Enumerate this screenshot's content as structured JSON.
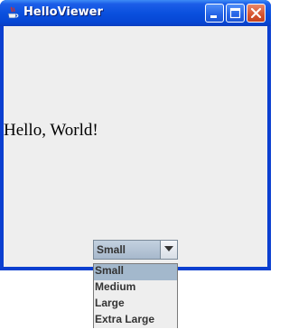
{
  "window": {
    "title": "HelloViewer",
    "icon": "java-cup-icon",
    "title_bar_color": "#0a50de",
    "close_button_color": "#d6532e"
  },
  "content": {
    "greeting": "Hello, World!"
  },
  "combo": {
    "selected": "Small",
    "options": [
      "Small",
      "Medium",
      "Large",
      "Extra Large"
    ]
  },
  "colors": {
    "client_bg": "#eeeeee",
    "combo_bg": "#b8c8d8",
    "selected_option_bg": "#a3b8cc"
  }
}
